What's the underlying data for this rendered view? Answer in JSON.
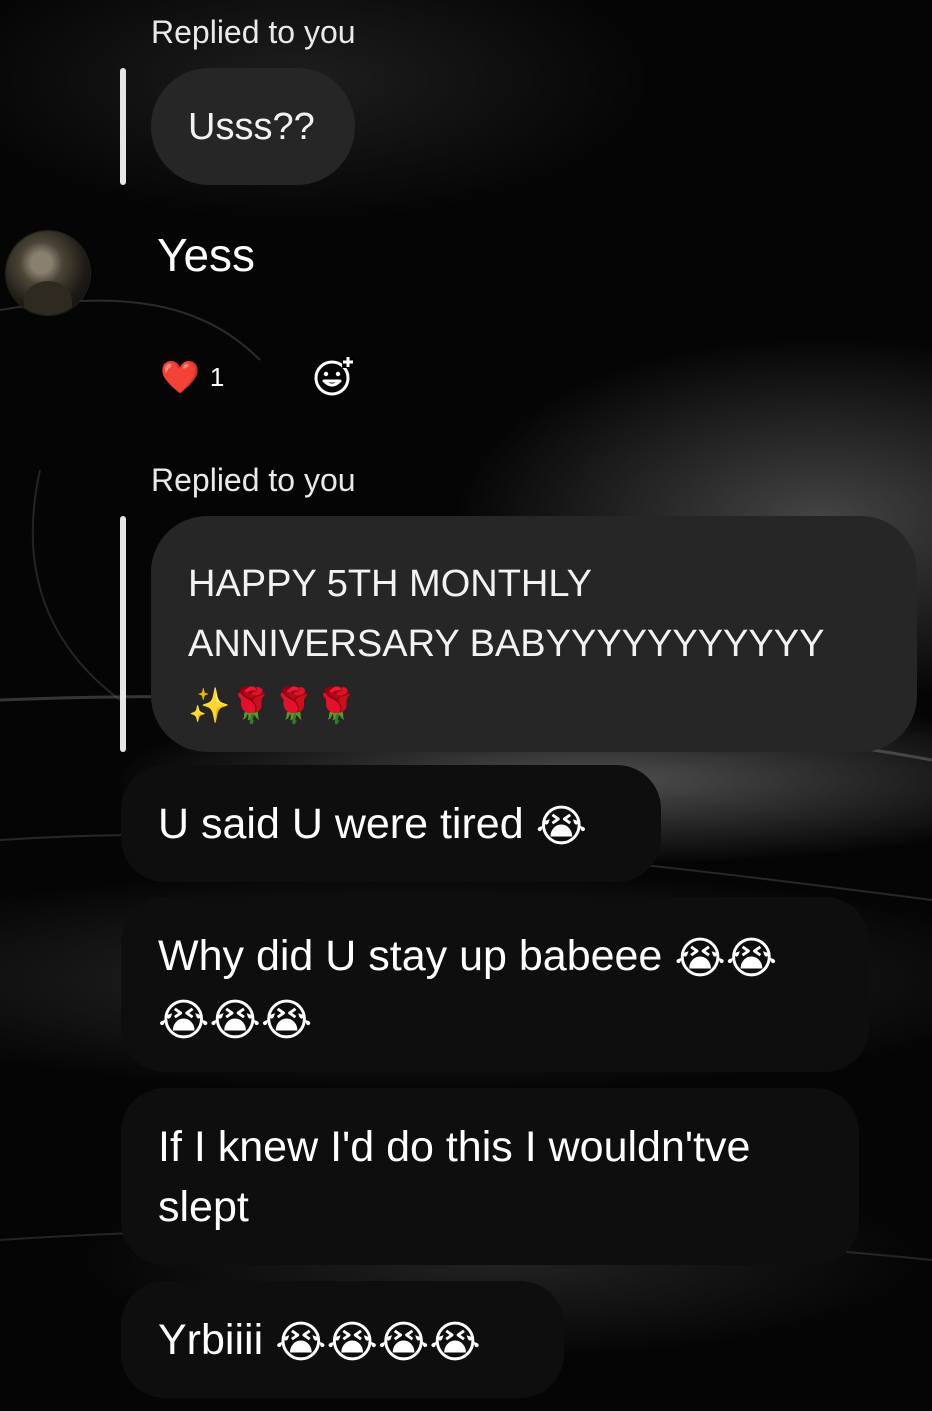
{
  "messages": [
    {
      "type": "reply_header",
      "text": "Replied to you"
    },
    {
      "type": "quoted",
      "text": "Usss??"
    },
    {
      "type": "incoming",
      "text": "Yess"
    },
    {
      "type": "reaction",
      "emoji": "❤️",
      "count": "1"
    },
    {
      "type": "reply_header",
      "text": "Replied to you"
    },
    {
      "type": "quoted",
      "text": "HAPPY 5TH MONTHLY ANNIVERSARY BABYYYYYYYYYYY",
      "emoji_line": "✨🌹🌹🌹"
    },
    {
      "type": "bubble",
      "text": "U said U were tired",
      "emoji": "😭"
    },
    {
      "type": "bubble",
      "text": "Why did U stay up babeee",
      "emoji": "😭😭",
      "emoji_line": "😭😭😭"
    },
    {
      "type": "bubble",
      "text": "If I knew I'd do this I wouldn'tve slept"
    },
    {
      "type": "bubble",
      "text": "Yrbiiii",
      "emoji": "😭😭😭😭"
    }
  ],
  "icons": {
    "avatar": "profile-avatar",
    "heart": "heart-emoji",
    "add_reaction": "add-reaction-icon",
    "cry": "loudly-crying-face-emoji"
  },
  "colors": {
    "background": "#000000",
    "quoted_bubble": "#262626",
    "bubble": "#0e0e0e",
    "text": "#ffffff"
  }
}
